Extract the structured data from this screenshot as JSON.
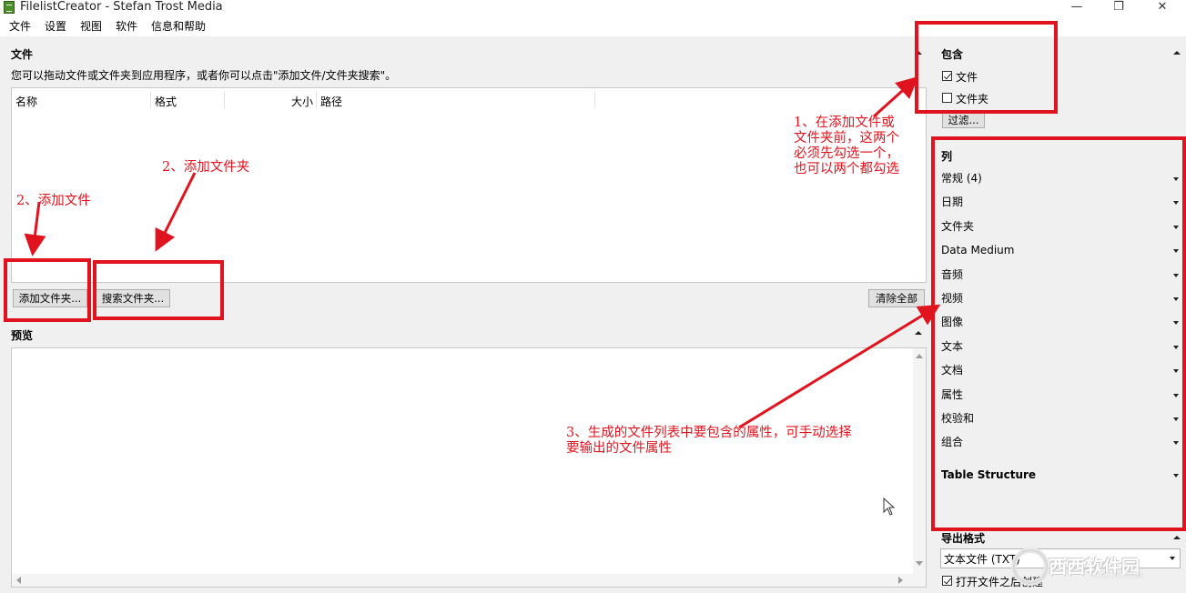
{
  "window": {
    "title": "FilelistCreator - Stefan Trost Media",
    "minimize": "—",
    "maximize": "❐",
    "close": "✕"
  },
  "menu": [
    "文件",
    "设置",
    "视图",
    "软件",
    "信息和帮助"
  ],
  "files_panel": {
    "title": "文件",
    "hint": "您可以拖动文件或文件夹到应用程序，或者你可以点击\"添加文件/文件夹搜索\"。",
    "columns": [
      "名称",
      "格式",
      "大小",
      "路径"
    ],
    "add_button": "添加文件夹...",
    "search_button": "搜索文件夹...",
    "clear_button": "清除全部"
  },
  "preview_panel": {
    "title": "预览"
  },
  "include_panel": {
    "title": "包含",
    "files_label": "文件",
    "files_checked": true,
    "folders_label": "文件夹",
    "folders_checked": false,
    "filter_button": "过滤..."
  },
  "columns_panel": {
    "title": "列",
    "items": [
      "常规 (4)",
      "日期",
      "文件夹",
      "Data Medium",
      "音频",
      "视频",
      "图像",
      "文本",
      "文档",
      "属性",
      "校验和",
      "组合"
    ],
    "table_structure": "Table Structure"
  },
  "export_panel": {
    "title": "导出格式",
    "format_value": "文本文件 (TXT)",
    "open_after_label": "打开文件之后创建",
    "open_after_checked": true
  },
  "annotations": {
    "note1": [
      "1、在添加文件或",
      "文件夹前，这两个",
      "必须先勾选一个，",
      "也可以两个都勾选"
    ],
    "note2_files": "2、添加文件",
    "note2_folder": "2、添加文件夹",
    "note3": [
      "3、生成的文件列表中要包含的属性，可手动选择",
      "要输出的文件属性"
    ]
  },
  "watermark": {
    "text": "西西软件园",
    "sub": "CR173.COM"
  },
  "colors": {
    "annotation_red": "#e0141e",
    "panel_bg": "#f0f0f0",
    "list_bg": "#ffffff"
  }
}
